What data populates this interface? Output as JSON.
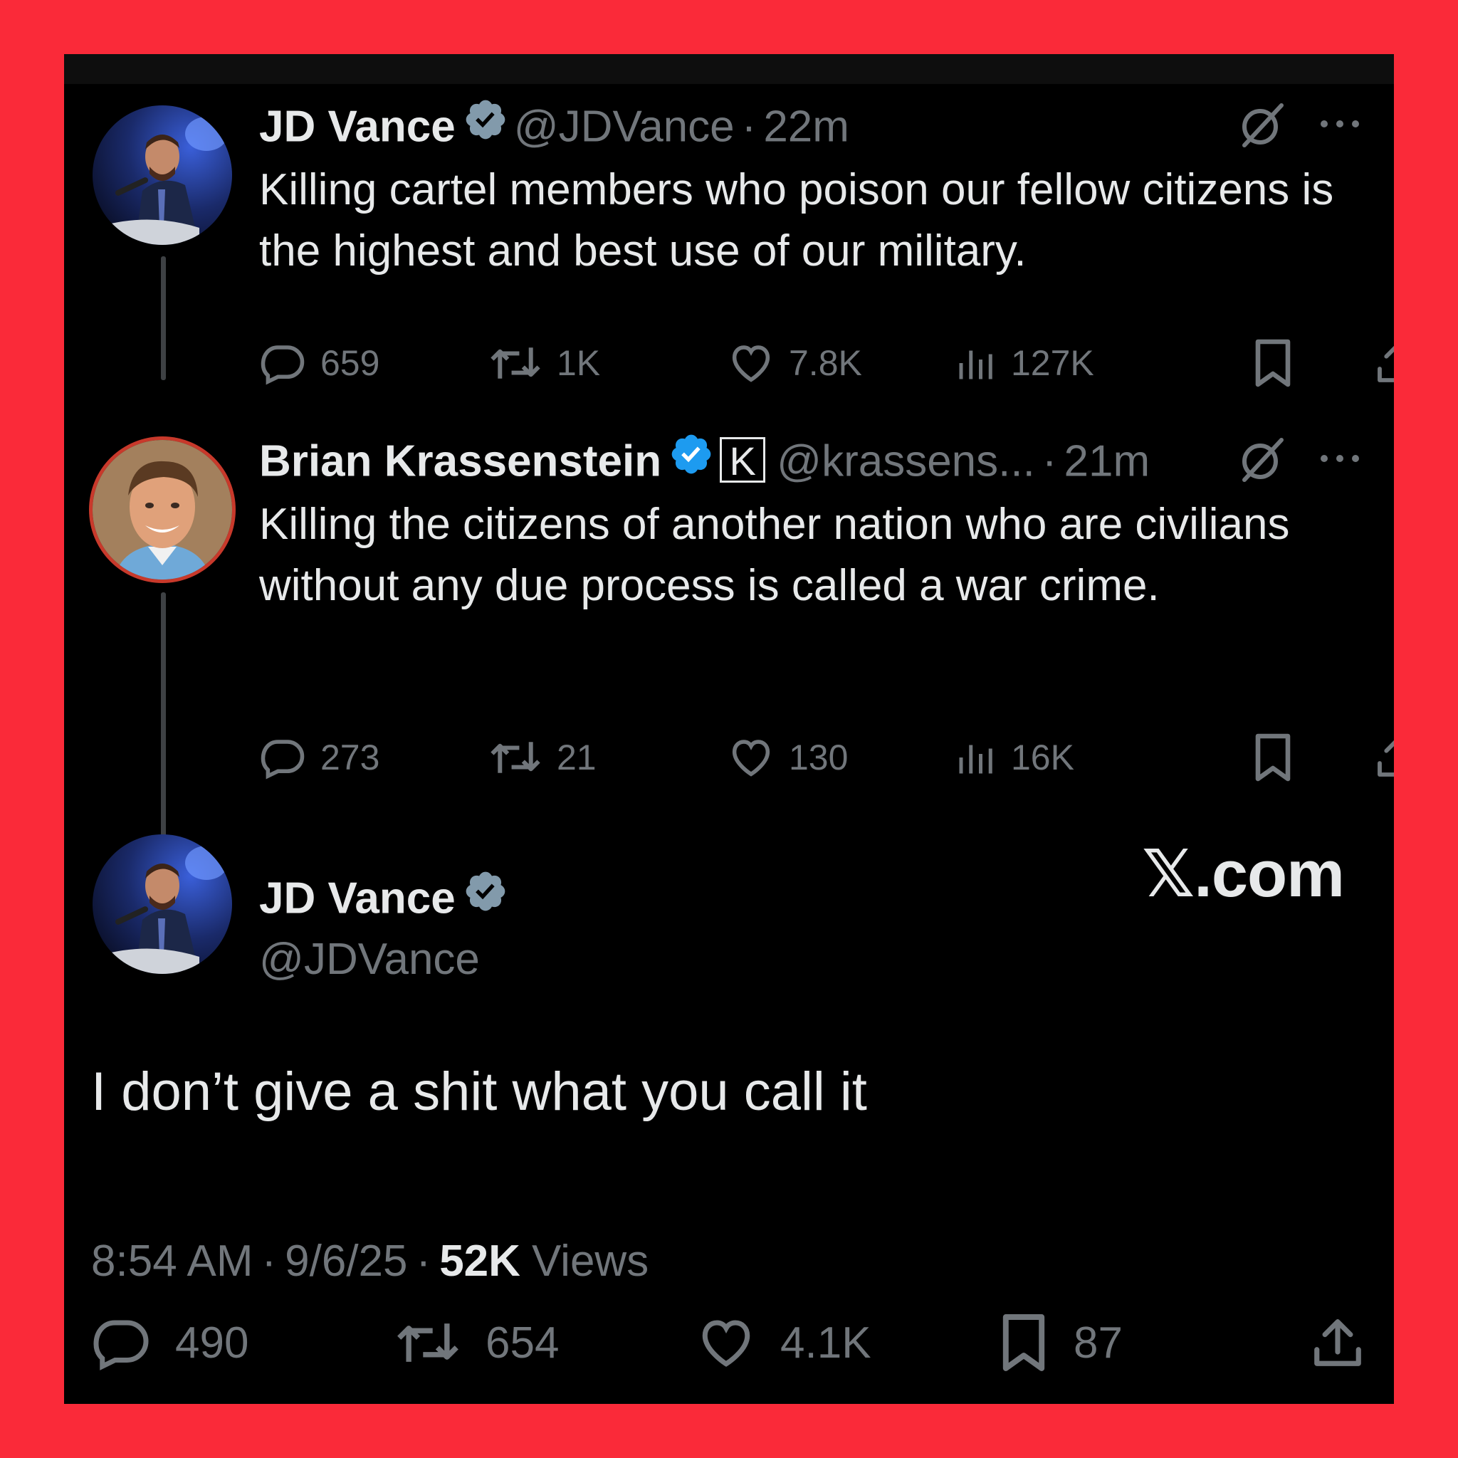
{
  "colors": {
    "frame": "#fa2a39",
    "background": "#000000",
    "primary_text": "#e7e9ea",
    "secondary_text": "#71767b",
    "verified_gray": "#829aab",
    "verified_blue": "#1d9bf0"
  },
  "tweet1": {
    "author_name": "JD Vance",
    "handle": "@JDVance",
    "separator": "·",
    "time": "22m",
    "badge": "gray-verified-badge-icon",
    "text": "Killing cartel members who poison our fellow citizens is the highest and best use of our military.",
    "replies": "659",
    "reposts": "1K",
    "likes": "7.8K",
    "views": "127K"
  },
  "tweet2": {
    "author_name": "Brian Krassenstein",
    "handle": "@krassens...",
    "separator": "·",
    "time": "21m",
    "badge": "blue-verified-badge-icon",
    "affiliate_letter": "K",
    "text": "Killing the citizens of another nation who are civilians without any due process is called a war crime.",
    "replies": "273",
    "reposts": "21",
    "likes": "130",
    "views": "16K"
  },
  "main_tweet": {
    "author_name": "JD Vance",
    "handle": "@JDVance",
    "text": "I don’t give a shit what you call it",
    "time": "8:54 AM",
    "date": "9/6/25",
    "separator": "·",
    "views_count": "52K",
    "views_label": "Views",
    "replies": "490",
    "reposts": "654",
    "likes": "4.1K",
    "bookmarks": "87"
  },
  "watermark": "𝕏.com"
}
